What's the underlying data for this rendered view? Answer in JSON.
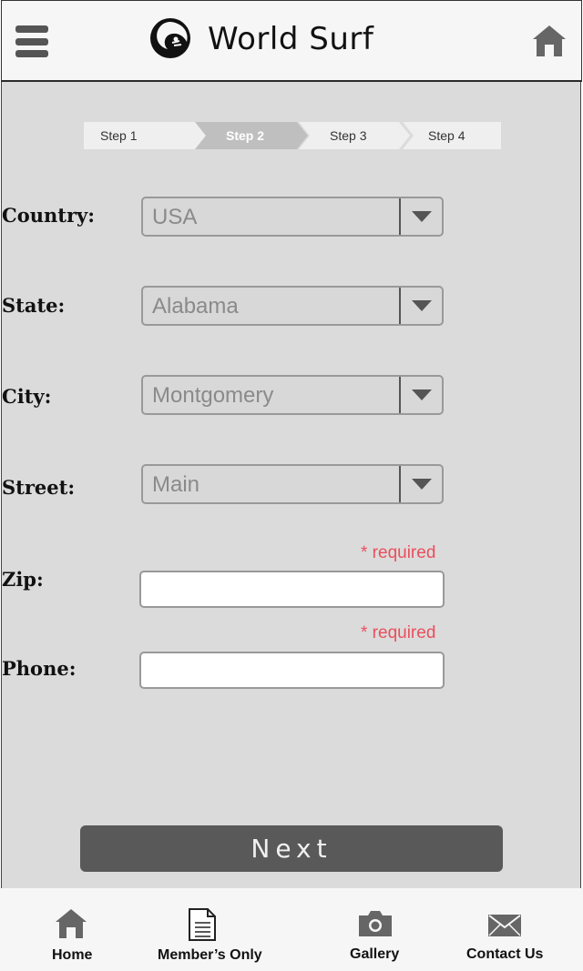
{
  "header": {
    "title": "World Surf",
    "menu_icon": "hamburger-menu-icon",
    "logo_icon": "wave-surfer-logo",
    "home_icon": "home-icon"
  },
  "stepper": {
    "steps": [
      "Step 1",
      "Step 2",
      "Step 3",
      "Step 4"
    ],
    "active_index": 1
  },
  "form": {
    "country": {
      "label": "Country:",
      "value": "USA"
    },
    "state": {
      "label": "State:",
      "value": "Alabama"
    },
    "city": {
      "label": "City:",
      "value": "Montgomery"
    },
    "street": {
      "label": "Street:",
      "value": "Main"
    },
    "zip": {
      "label": "Zip:",
      "value": "",
      "required_note": "* required"
    },
    "phone": {
      "label": "Phone:",
      "value": "",
      "required_note": "* required"
    }
  },
  "next_label": "Next",
  "bottom_nav": {
    "items": [
      {
        "label": "Home",
        "icon": "home-icon"
      },
      {
        "label": "Member’s Only",
        "icon": "document-icon"
      },
      {
        "label": "Gallery",
        "icon": "camera-icon"
      },
      {
        "label": "Contact Us",
        "icon": "envelope-icon"
      }
    ]
  },
  "colors": {
    "background": "#dcdbdc",
    "header_bg": "#f7f6f6",
    "active_step": "#c0bfc0",
    "required": "#e8505b",
    "button": "#5a595a"
  }
}
